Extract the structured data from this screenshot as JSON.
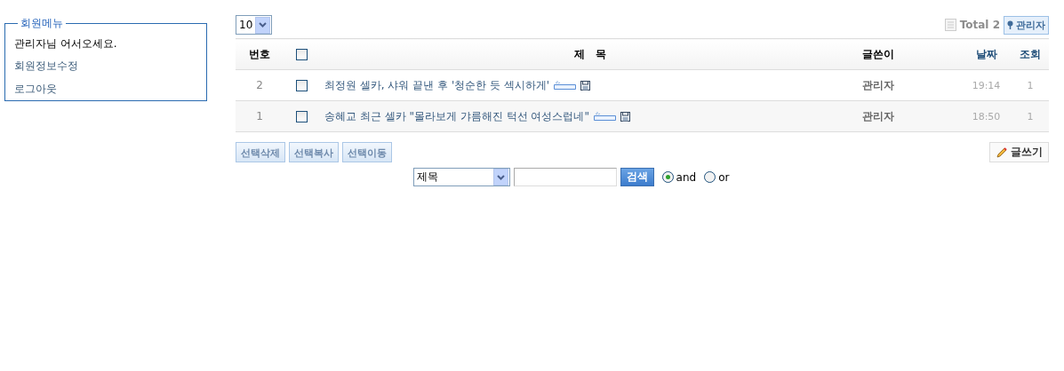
{
  "member_menu": {
    "title": "회원메뉴",
    "greeting": "관리자님 어서오세요.",
    "links": [
      "회원정보수정",
      "로그아웃"
    ]
  },
  "board": {
    "page_size": "10",
    "total_label": "Total 2",
    "admin_button": "관리자",
    "columns": [
      "번호",
      "제　목",
      "글쓴이",
      "날짜",
      "조회"
    ],
    "select_all": {
      "checked": false
    },
    "rows": [
      {
        "number": "2",
        "checked": false,
        "title": "최정원 셀카, 샤워 끝낸 후 '청순한 듯 섹시하게'",
        "new": true,
        "attachment": true,
        "author": "관리자",
        "date": "19:14",
        "views": "1"
      },
      {
        "number": "1",
        "checked": false,
        "title": "송혜교 최근 셀카 \"몰라보게 갸름해진 턱선 여성스럽네\"",
        "new": true,
        "attachment": true,
        "author": "관리자",
        "date": "18:50",
        "views": "1"
      }
    ],
    "actions": [
      "선택삭제",
      "선택복사",
      "선택이동"
    ],
    "write_button": "글쓰기",
    "search": {
      "field": "제목",
      "button": "검색",
      "options": [
        {
          "label": "and",
          "selected": true
        },
        {
          "label": "or",
          "selected": false
        }
      ]
    }
  }
}
